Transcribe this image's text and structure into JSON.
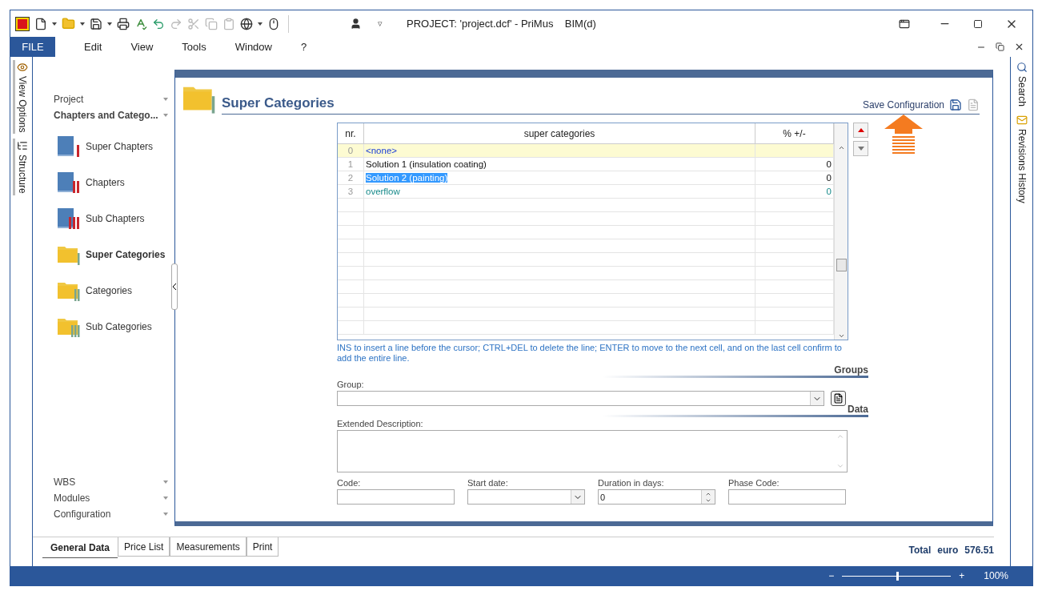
{
  "window": {
    "title": "PROJECT: 'project.dcf' - PriMus    BIM(d)",
    "user_menu": "▿"
  },
  "menu": [
    {
      "label": "FILE",
      "kind": "file"
    },
    {
      "label": "Edit",
      "kind": "item"
    },
    {
      "label": "View",
      "kind": "item"
    },
    {
      "label": "Tools",
      "kind": "item"
    },
    {
      "label": "Window",
      "kind": "item"
    },
    {
      "label": "?",
      "kind": "item"
    }
  ],
  "left_strip": [
    {
      "label": "View Options"
    },
    {
      "label": "Structure"
    }
  ],
  "right_strip": [
    {
      "label": "Search"
    },
    {
      "label": "Revisions History"
    }
  ],
  "nav": {
    "sections_top": [
      {
        "label": "Project",
        "expanded": false
      },
      {
        "label": "Chapters and Catego...",
        "expanded": true
      }
    ],
    "items": [
      {
        "label": "Super Chapters",
        "kind": "book",
        "selected": false
      },
      {
        "label": "Chapters",
        "kind": "book",
        "selected": false
      },
      {
        "label": "Sub Chapters",
        "kind": "book",
        "selected": false
      },
      {
        "label": "Super Categories",
        "kind": "folder",
        "selected": true
      },
      {
        "label": "Categories",
        "kind": "folder",
        "selected": false
      },
      {
        "label": "Sub Categories",
        "kind": "folder",
        "selected": false
      }
    ],
    "sections_bottom": [
      {
        "label": "WBS"
      },
      {
        "label": "Modules"
      },
      {
        "label": "Configuration"
      }
    ]
  },
  "panel": {
    "title": "Super Categories",
    "save_configuration": "Save Configuration",
    "table": {
      "columns": [
        "nr.",
        "super categories",
        "% +/-"
      ],
      "rows": [
        {
          "nr": "0",
          "name": "<none>",
          "percent": "",
          "kind": "none",
          "current": true,
          "selected": false
        },
        {
          "nr": "1",
          "name": "Solution 1 (insulation coating)",
          "percent": "0",
          "kind": "item",
          "current": false,
          "selected": false
        },
        {
          "nr": "2",
          "name": "Solution 2 (painting)",
          "percent": "0",
          "kind": "item",
          "current": false,
          "selected": true
        },
        {
          "nr": "3",
          "name": "overflow",
          "percent": "0",
          "kind": "overflow",
          "current": false,
          "selected": false
        }
      ]
    },
    "hint": "INS to insert a line before the cursor; CTRL+DEL to delete the line; ENTER to move to the next cell, and on the last cell confirm to add the entire line.",
    "groups_heading": "Groups",
    "group_label": "Group:",
    "data_heading": "Data",
    "extended_description_label": "Extended Description:",
    "fields": [
      {
        "label": "Code:",
        "kind": "text"
      },
      {
        "label": "Start date:",
        "kind": "date"
      },
      {
        "label": "Duration in days:",
        "kind": "spin",
        "value": "0"
      },
      {
        "label": "Phase Code:",
        "kind": "text"
      }
    ]
  },
  "bottom_tabs": [
    {
      "label": "General Data",
      "selected": true
    },
    {
      "label": "Price List",
      "selected": false
    },
    {
      "label": "Measurements",
      "selected": false
    },
    {
      "label": "Print",
      "selected": false
    }
  ],
  "total": {
    "label": "Total",
    "currency": "euro",
    "amount": "576.51"
  },
  "status_bar": {
    "zoom_out": "−",
    "zoom_in": "+",
    "zoom": "100%",
    "level": 0.5
  }
}
